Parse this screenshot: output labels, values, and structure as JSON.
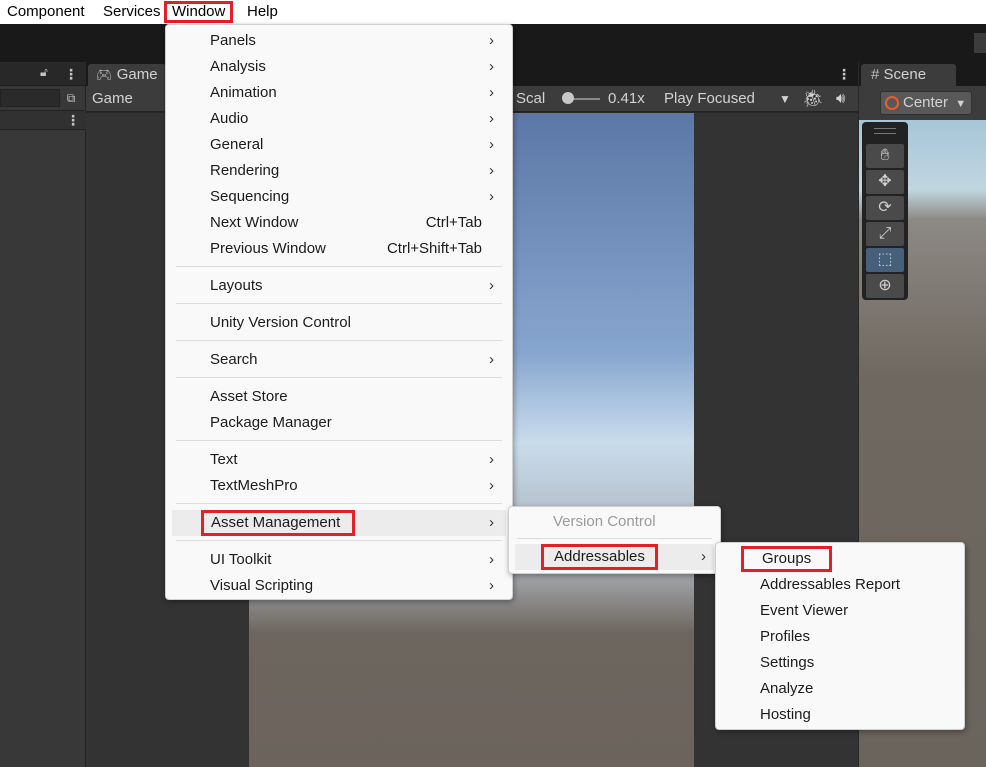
{
  "menubar": {
    "items": [
      {
        "label": "Component"
      },
      {
        "label": "Services"
      },
      {
        "label": "Window"
      },
      {
        "label": "Help"
      }
    ]
  },
  "game_panel": {
    "tab_label": "Game",
    "display_label": "Game",
    "scale_label": "Scal",
    "scale_value": "0.41x",
    "play_mode": "Play Focused"
  },
  "scene_panel": {
    "tab_label": "Scene",
    "pivot_label": "Center"
  },
  "window_menu": {
    "items": [
      {
        "label": "Panels",
        "submenu": true
      },
      {
        "label": "Analysis",
        "submenu": true
      },
      {
        "label": "Animation",
        "submenu": true
      },
      {
        "label": "Audio",
        "submenu": true
      },
      {
        "label": "General",
        "submenu": true
      },
      {
        "label": "Rendering",
        "submenu": true
      },
      {
        "label": "Sequencing",
        "submenu": true
      },
      {
        "label": "Next Window",
        "shortcut": "Ctrl+Tab"
      },
      {
        "label": "Previous Window",
        "shortcut": "Ctrl+Shift+Tab"
      },
      {
        "label": "Layouts",
        "submenu": true
      },
      {
        "label": "Unity Version Control"
      },
      {
        "label": "Search",
        "submenu": true
      },
      {
        "label": "Asset Store"
      },
      {
        "label": "Package Manager"
      },
      {
        "label": "Text",
        "submenu": true
      },
      {
        "label": "TextMeshPro",
        "submenu": true
      },
      {
        "label": "Asset Management",
        "submenu": true
      },
      {
        "label": "UI Toolkit",
        "submenu": true
      },
      {
        "label": "Visual Scripting",
        "submenu": true
      }
    ]
  },
  "asset_management_menu": {
    "items": [
      {
        "label": "Version Control",
        "disabled": true
      },
      {
        "label": "Addressables",
        "submenu": true
      }
    ]
  },
  "addressables_menu": {
    "items": [
      {
        "label": "Groups"
      },
      {
        "label": "Addressables Report"
      },
      {
        "label": "Event Viewer"
      },
      {
        "label": "Profiles"
      },
      {
        "label": "Settings"
      },
      {
        "label": "Analyze"
      },
      {
        "label": "Hosting"
      }
    ]
  },
  "icons": {
    "submenu_arrow": "chevron-right-icon",
    "lock": "lock-icon",
    "more": "kebab-menu-icon",
    "gamepad": "gamepad-icon",
    "grid": "hash-grid-icon",
    "bug": "bug-icon",
    "audio": "speaker-icon"
  },
  "colors": {
    "highlight_box": "#e41f26",
    "menu_background": "#f9f9f9",
    "editor_dark": "#282828"
  }
}
